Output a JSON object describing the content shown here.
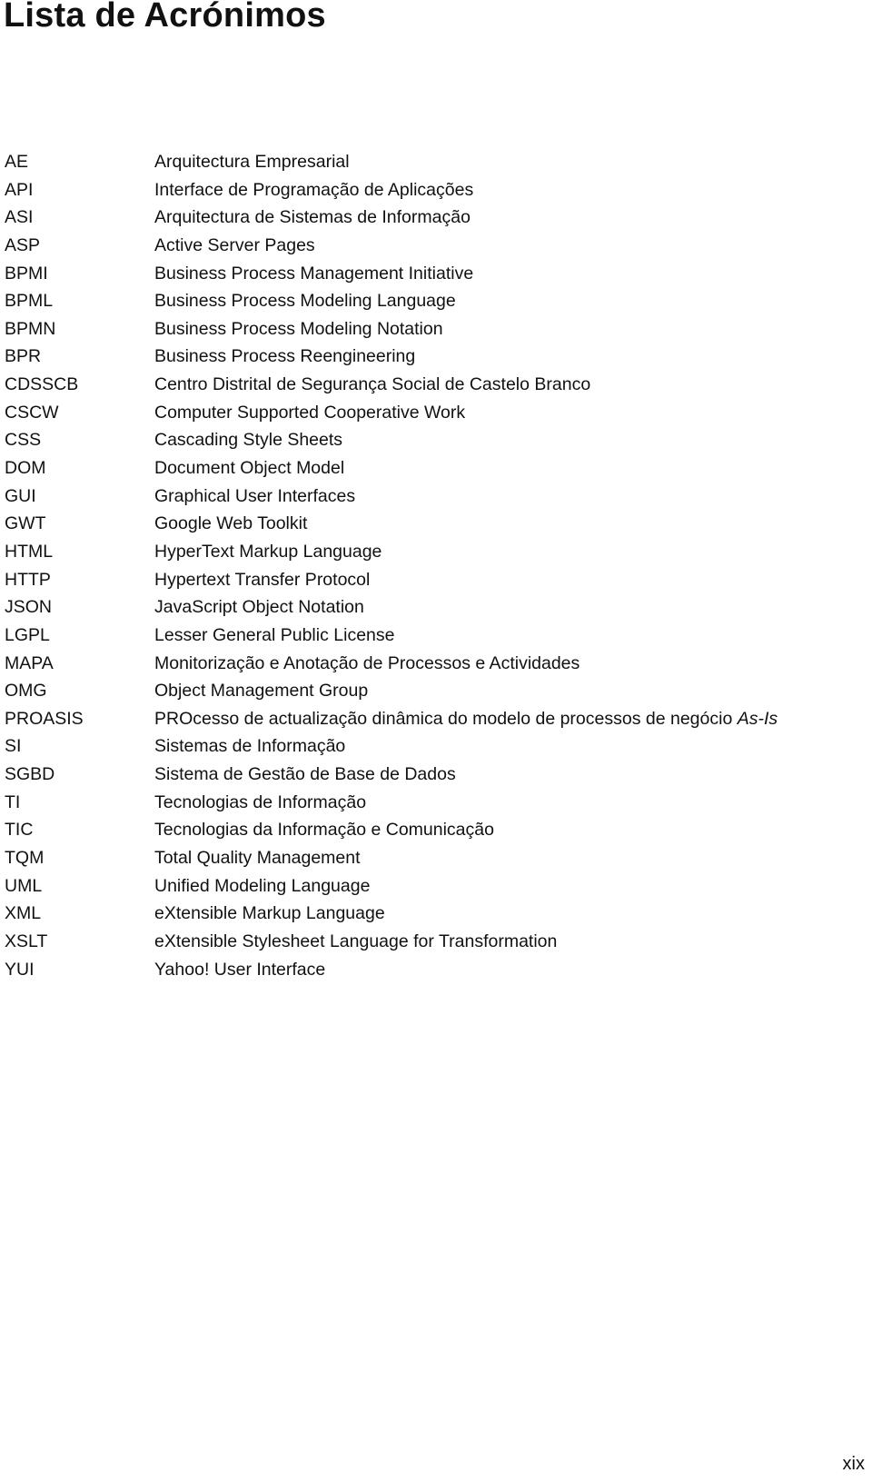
{
  "title": "Lista de Acrónimos",
  "acronyms": [
    {
      "acronym": "AE",
      "definition": "Arquitectura Empresarial"
    },
    {
      "acronym": "API",
      "definition": "Interface de Programação de Aplicações"
    },
    {
      "acronym": "ASI",
      "definition": "Arquitectura de Sistemas de Informação"
    },
    {
      "acronym": "ASP",
      "definition": "Active Server Pages"
    },
    {
      "acronym": "BPMI",
      "definition": "Business Process Management Initiative"
    },
    {
      "acronym": "BPML",
      "definition": "Business Process Modeling Language"
    },
    {
      "acronym": "BPMN",
      "definition": "Business Process Modeling Notation"
    },
    {
      "acronym": "BPR",
      "definition": "Business Process Reengineering"
    },
    {
      "acronym": "CDSSCB",
      "definition": "Centro Distrital de Segurança Social de Castelo Branco"
    },
    {
      "acronym": "CSCW",
      "definition": "Computer Supported Cooperative Work"
    },
    {
      "acronym": "CSS",
      "definition": "Cascading Style Sheets"
    },
    {
      "acronym": "DOM",
      "definition": "Document Object Model"
    },
    {
      "acronym": "GUI",
      "definition": "Graphical User Interfaces"
    },
    {
      "acronym": "GWT",
      "definition": "Google Web Toolkit"
    },
    {
      "acronym": "HTML",
      "definition": "HyperText Markup Language"
    },
    {
      "acronym": "HTTP",
      "definition": "Hypertext Transfer Protocol"
    },
    {
      "acronym": "JSON",
      "definition": "JavaScript Object Notation"
    },
    {
      "acronym": "LGPL",
      "definition": "Lesser General Public License"
    },
    {
      "acronym": "MAPA",
      "definition": "Monitorização e Anotação de Processos e Actividades"
    },
    {
      "acronym": "OMG",
      "definition": "Object Management Group"
    },
    {
      "acronym": "PROASIS",
      "definition": "PROcesso de actualização dinâmica do modelo de processos de negócio ",
      "definition_italic": "As-Is"
    },
    {
      "acronym": "SI",
      "definition": "Sistemas de Informação"
    },
    {
      "acronym": "SGBD",
      "definition": "Sistema de Gestão de Base de Dados"
    },
    {
      "acronym": "TI",
      "definition": "Tecnologias de Informação"
    },
    {
      "acronym": "TIC",
      "definition": "Tecnologias da Informação e Comunicação"
    },
    {
      "acronym": "TQM",
      "definition": "Total Quality Management"
    },
    {
      "acronym": "UML",
      "definition": "Unified Modeling Language"
    },
    {
      "acronym": "XML",
      "definition": "eXtensible Markup Language"
    },
    {
      "acronym": "XSLT",
      "definition": "eXtensible Stylesheet Language for Transformation"
    },
    {
      "acronym": "YUI",
      "definition": "Yahoo! User Interface"
    }
  ],
  "page_number": "xix"
}
